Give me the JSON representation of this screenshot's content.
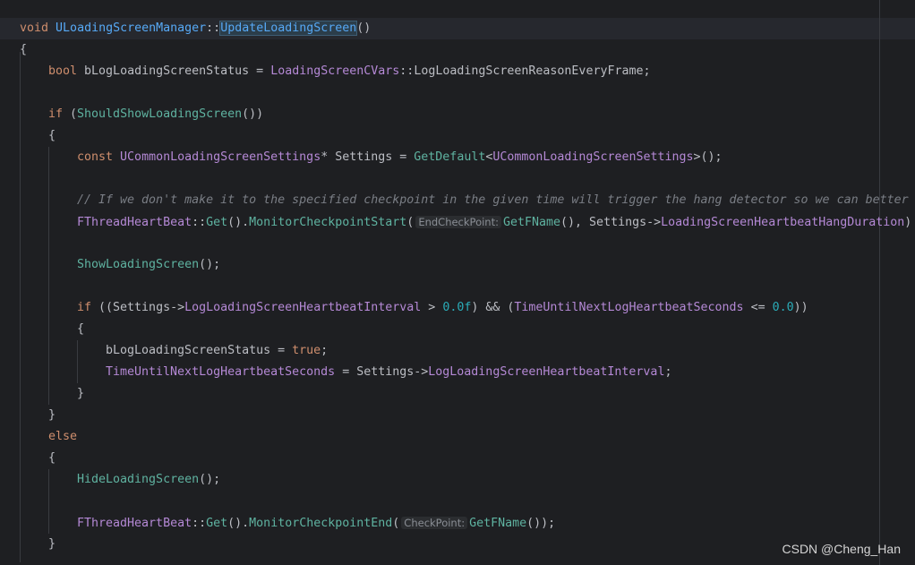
{
  "code": {
    "l1": {
      "kw_void": "void",
      "cls": "ULoadingScreenManager",
      "sep": "::",
      "fn": "UpdateLoadingScreen",
      "paren": "()"
    },
    "l2": {
      "brace": "{"
    },
    "l3": {
      "kw_bool": "bool",
      "var": " bLogLoadingScreenStatus = ",
      "ns": "LoadingScreenCVars",
      "sep": "::",
      "member": "LogLoadingScreenReasonEveryFrame",
      "end": ";"
    },
    "l5": {
      "kw_if": "if",
      "open": " (",
      "fn": "ShouldShowLoadingScreen",
      "close": "())"
    },
    "l6": {
      "brace": "{"
    },
    "l7": {
      "kw_const": "const",
      "type": "UCommonLoadingScreenSettings",
      "var": "* Settings = ",
      "fn": "GetDefault",
      "lt": "<",
      "type2": "UCommonLoadingScreenSettings",
      "end": ">();"
    },
    "l9": {
      "comment": "// If we don't make it to the specified checkpoint in the given time will trigger the hang detector so we can better"
    },
    "l10": {
      "cls": "FThreadHeartBeat",
      "sep": "::",
      "get": "Get",
      "p1": "().",
      "fn": "MonitorCheckpointStart",
      "open": "(",
      "hint": "EndCheckPoint:",
      "gfn": "GetFName",
      "mid": "(), Settings->",
      "field": "LoadingScreenHeartbeatHangDuration",
      "end": ")"
    },
    "l12": {
      "fn": "ShowLoadingScreen",
      "end": "();"
    },
    "l14": {
      "kw_if": "if",
      "open": " ((Settings->",
      "field": "LogLoadingScreenHeartbeatInterval",
      "gt": " > ",
      "num1": "0.0f",
      "and": ") && (",
      "var2": "TimeUntilNextLogHeartbeatSeconds",
      "le": " <= ",
      "num2": "0.0",
      "close": "))"
    },
    "l15": {
      "brace": "{"
    },
    "l16": {
      "var": "bLogLoadingScreenStatus = ",
      "val": "true",
      "end": ";"
    },
    "l17": {
      "var": "TimeUntilNextLogHeartbeatSeconds",
      "mid": " = Settings->",
      "field": "LogLoadingScreenHeartbeatInterval",
      "end": ";"
    },
    "l18": {
      "brace": "}"
    },
    "l19": {
      "brace": "}"
    },
    "l20": {
      "kw_else": "else"
    },
    "l21": {
      "brace": "{"
    },
    "l22": {
      "fn": "HideLoadingScreen",
      "end": "();"
    },
    "l24": {
      "cls": "FThreadHeartBeat",
      "sep": "::",
      "get": "Get",
      "p1": "().",
      "fn": "MonitorCheckpointEnd",
      "open": "(",
      "hint": "CheckPoint:",
      "gfn": "GetFName",
      "end": "());"
    },
    "l25": {
      "brace": "}"
    }
  },
  "watermark": "CSDN @Cheng_Han",
  "colors": {
    "background": "#1e1f22",
    "keyword": "#cf8e6d",
    "type": "#c77dbb",
    "function": "#56a8f5",
    "comment": "#7a7e85",
    "number": "#2aacb8"
  }
}
